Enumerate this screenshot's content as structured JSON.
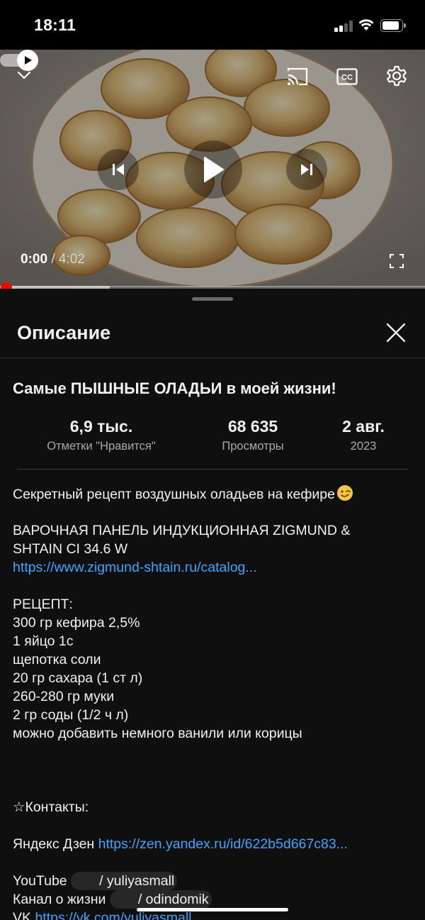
{
  "status_bar": {
    "time": "18:11"
  },
  "player": {
    "time_current": "0:00",
    "time_separator": "/",
    "time_total": "4:02",
    "progress_fraction": 0.0
  },
  "panel": {
    "title": "Описание",
    "video_title": "Самые ПЫШНЫЕ ОЛАДЬИ в моей жизни!",
    "stats": [
      {
        "value": "6,9 тыс.",
        "label": "Отметки \"Нравится\""
      },
      {
        "value": "68 635",
        "label": "Просмотры"
      },
      {
        "value": "2 авг.",
        "label": "2023"
      }
    ]
  },
  "description": {
    "intro": "Секретный рецепт воздушных оладьев на кефире",
    "intro_emoji": "wink-emoji-icon",
    "product_line1": "ВАРОЧНАЯ ПАНЕЛЬ ИНДУКЦИОННАЯ ZIGMUND &",
    "product_line2": "SHTAIN CI 34.6 W",
    "product_link": "https://www.zigmund-shtain.ru/catalog...",
    "recipe_heading": "РЕЦЕПТ:",
    "recipe_items": [
      "300 гр кефира 2,5%",
      "1 яйцо 1с",
      "щепотка соли",
      "20 гр сахара (1 ст л)",
      "260-280 гр муки",
      "2 гр соды (1/2 ч л)",
      "можно добавить немного ванили или корицы"
    ],
    "contacts_heading": "☆Контакты:",
    "zen_label": "Яндекс Дзен",
    "zen_link": "https://zen.yandex.ru/id/622b5d667c83...",
    "youtube_label": "YouTube",
    "youtube_handle": "/ yuliyasmall",
    "life_label": "Канал о жизни",
    "life_handle": "/ odindomik",
    "vk_label": "VK",
    "vk_link": "https://vk.com/yuliyasmall"
  }
}
